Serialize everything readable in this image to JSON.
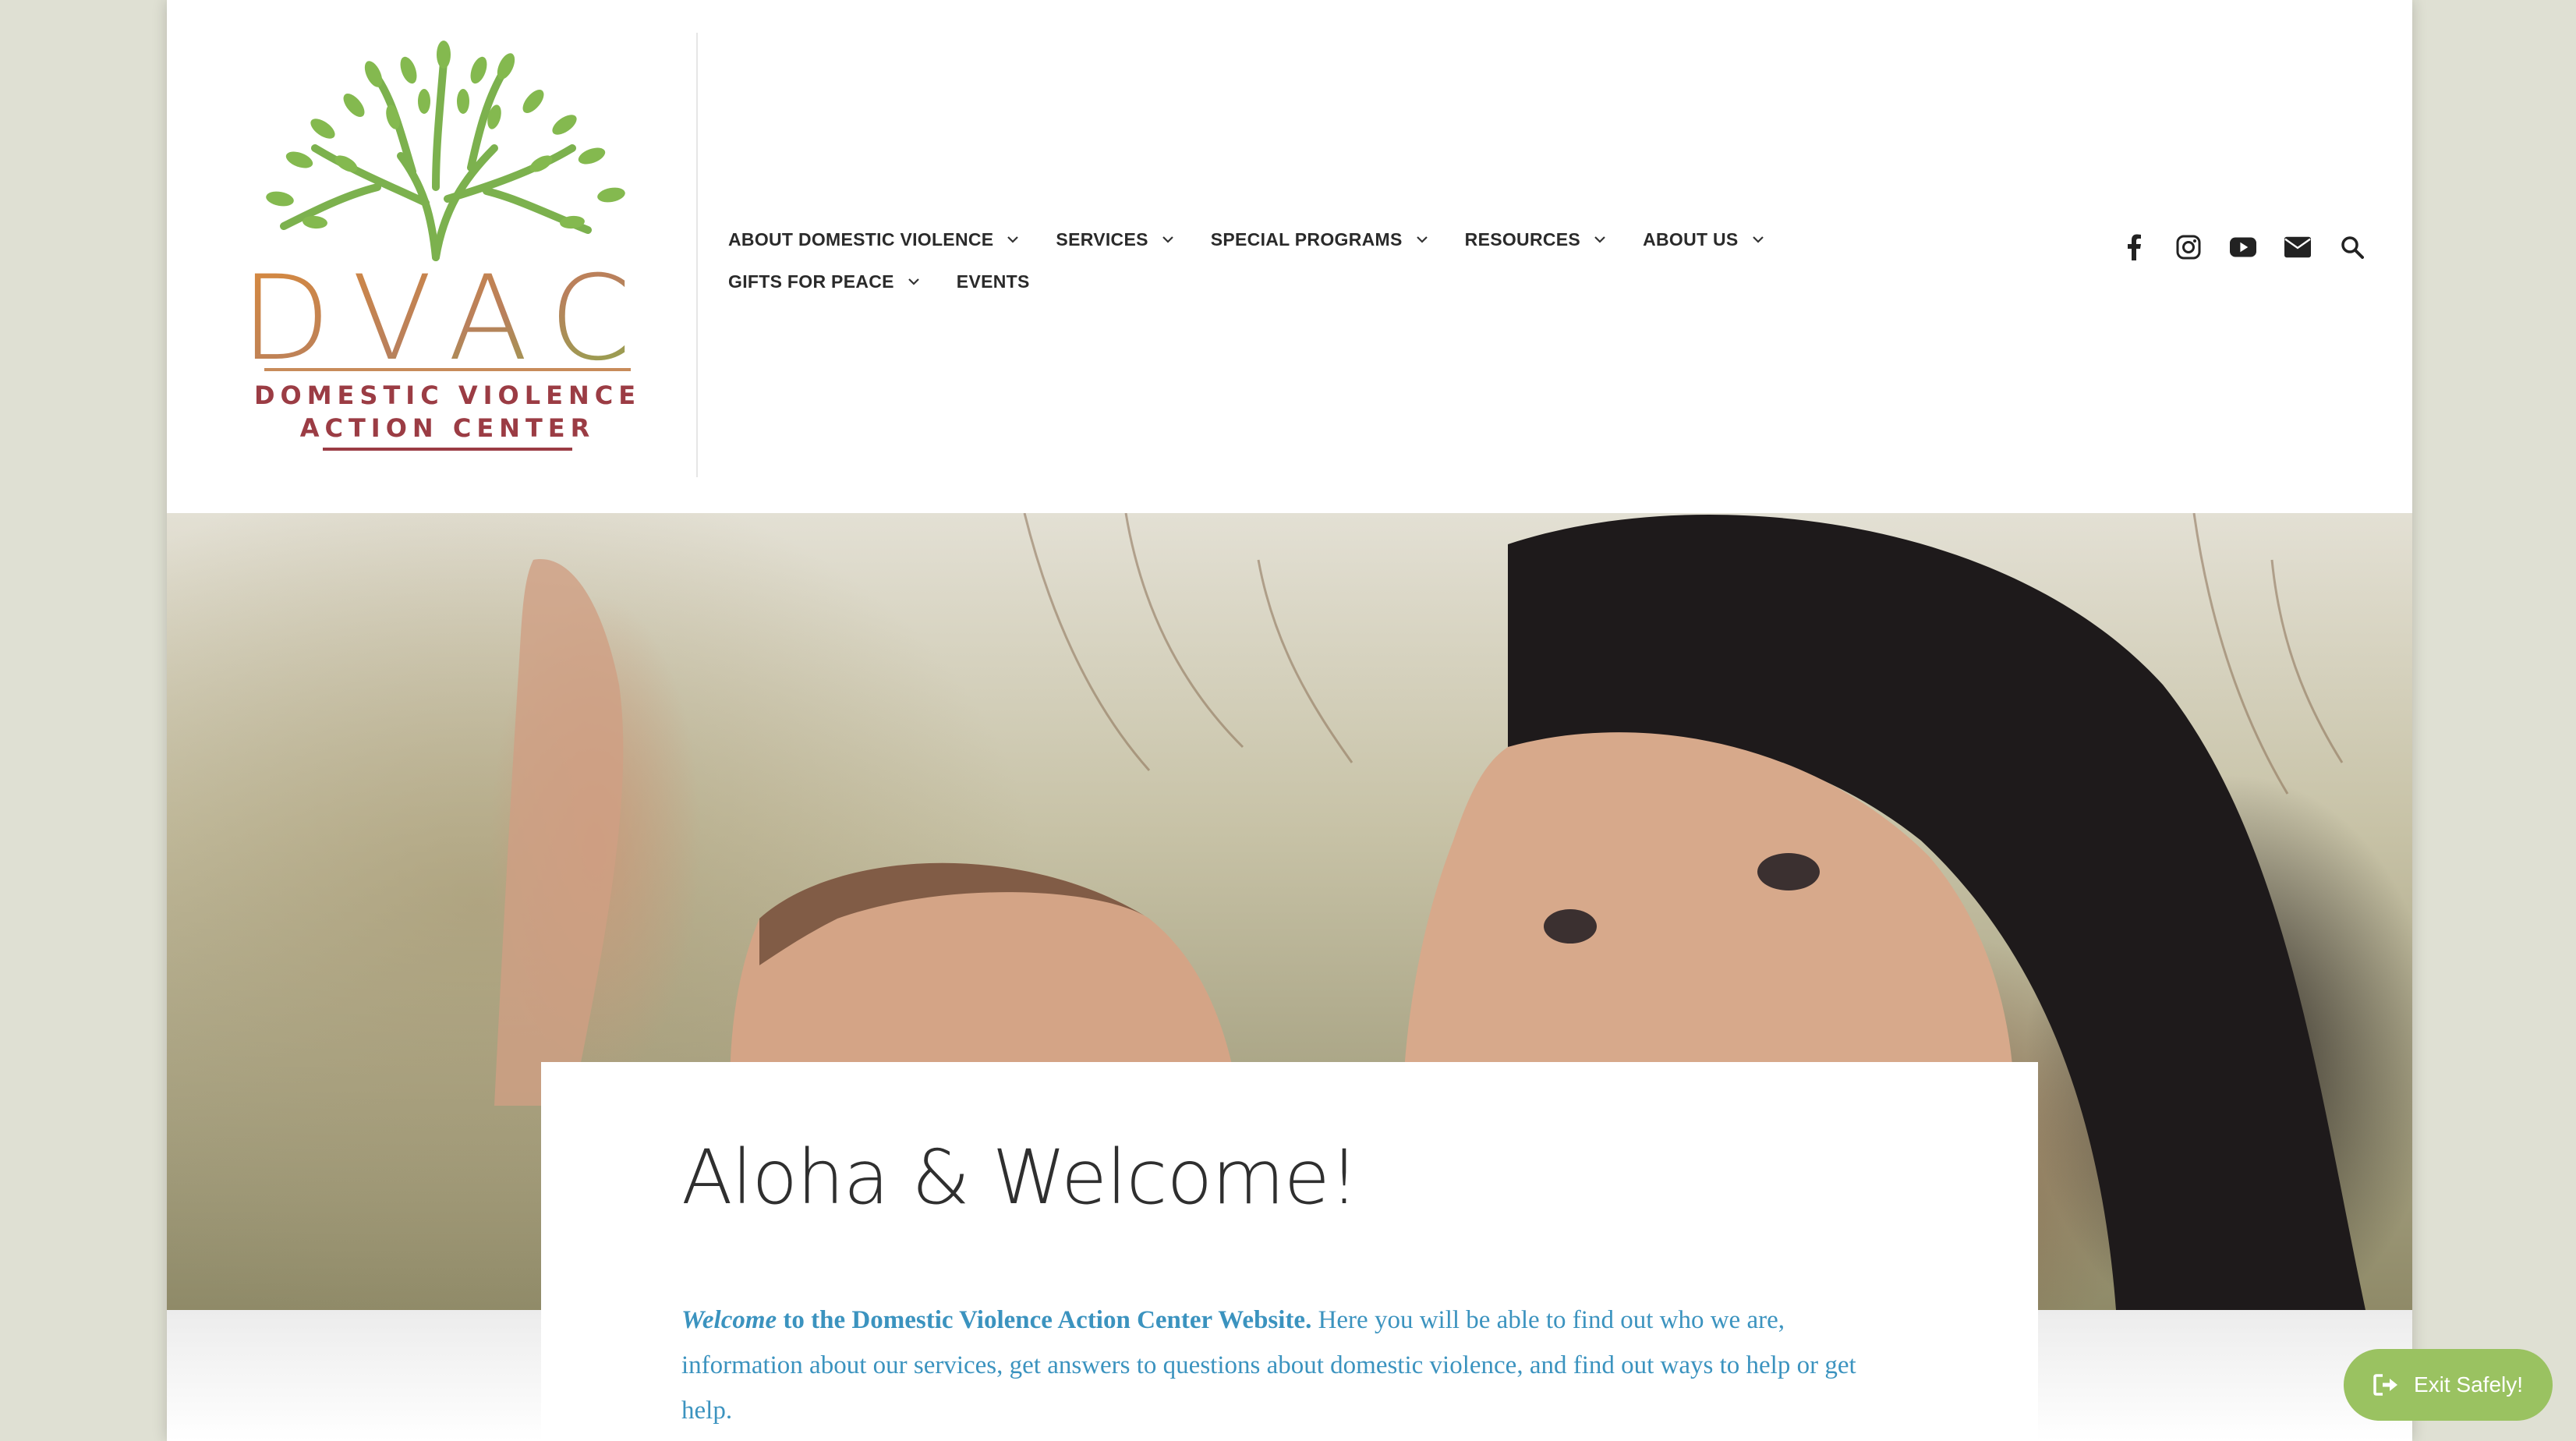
{
  "logo": {
    "letters": "DVAC",
    "line1": "DOMESTIC VIOLENCE",
    "line2": "ACTION CENTER"
  },
  "nav": {
    "row1": [
      {
        "label": "ABOUT DOMESTIC VIOLENCE",
        "has_dropdown": true
      },
      {
        "label": "SERVICES",
        "has_dropdown": true
      },
      {
        "label": "SPECIAL PROGRAMS",
        "has_dropdown": true
      },
      {
        "label": "RESOURCES",
        "has_dropdown": true
      },
      {
        "label": "ABOUT US",
        "has_dropdown": true
      }
    ],
    "row2": [
      {
        "label": "GIFTS FOR PEACE",
        "has_dropdown": true
      },
      {
        "label": "EVENTS",
        "has_dropdown": false
      }
    ]
  },
  "social": [
    "facebook-icon",
    "instagram-icon",
    "youtube-icon",
    "envelope-icon",
    "search-icon"
  ],
  "welcome": {
    "title": "Aloha & Welcome!",
    "intro_em": "Welcome",
    "intro_strong": " to the Domestic Violence Action Center Website.",
    "body": " Here you will be able to find out who we are, information about our services, get answers to questions about domestic violence, and find out ways to help or get help."
  },
  "exit_button": {
    "label": "Exit Safely!"
  },
  "colors": {
    "background": "#dfe0d3",
    "nav_text": "#2a2a2a",
    "link_blue": "#3b93bf",
    "exit_green": "#9ac261",
    "logo_green": "#7cb14e",
    "logo_orange": "#d98a3c",
    "logo_maroon": "#9b3c44"
  }
}
